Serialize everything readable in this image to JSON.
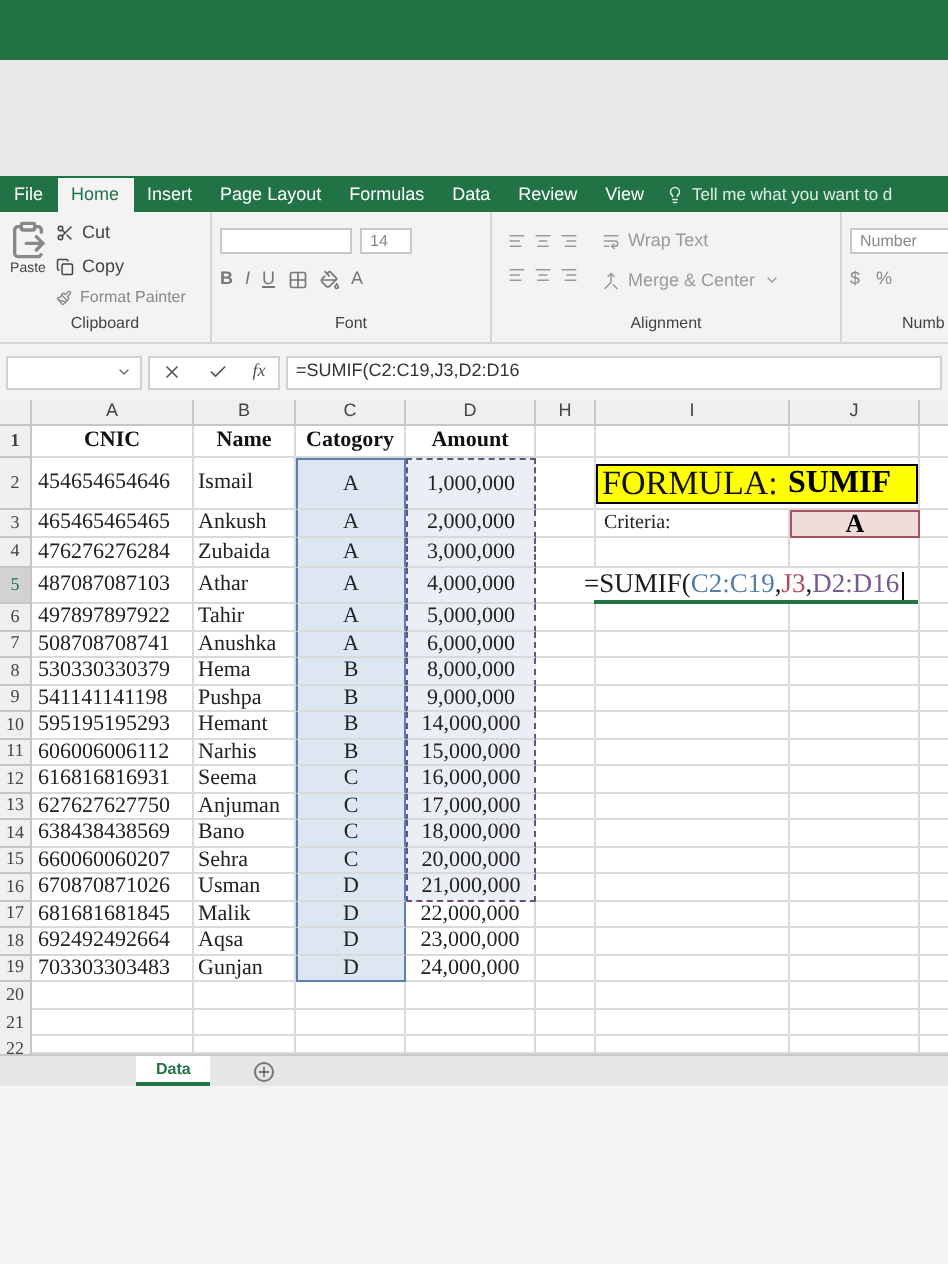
{
  "ribbon_tabs": [
    {
      "label": "File",
      "selected": false
    },
    {
      "label": "Home",
      "selected": true
    },
    {
      "label": "Insert",
      "selected": false
    },
    {
      "label": "Page Layout",
      "selected": false
    },
    {
      "label": "Formulas",
      "selected": false
    },
    {
      "label": "Data",
      "selected": false
    },
    {
      "label": "Review",
      "selected": false
    },
    {
      "label": "View",
      "selected": false
    }
  ],
  "tell_me": "Tell me what you want to d",
  "clipboard": {
    "paste": "Paste",
    "cut": "Cut",
    "copy": "Copy",
    "format_painter": "Format Painter",
    "label": "Clipboard"
  },
  "font": {
    "size": "14",
    "bold": "B",
    "italic": "I",
    "underline": "U",
    "font_color": "A",
    "label": "Font"
  },
  "alignment": {
    "wrap": "Wrap Text",
    "merge": "Merge & Center",
    "label": "Alignment"
  },
  "number": {
    "format": "Number",
    "currency": "$",
    "percent": "%",
    "label": "Numb"
  },
  "formula_bar": {
    "function_label": "fx",
    "formula": "=SUMIF(C2:C19,J3,D2:D16"
  },
  "header_row_number": "1",
  "columns": [
    "A",
    "B",
    "C",
    "D",
    "H",
    "I",
    "J"
  ],
  "headers": [
    "CNIC",
    "Name",
    "Catogory",
    "Amount"
  ],
  "rows": [
    {
      "number": "2",
      "cnic": "454654654646",
      "name": "Ismail",
      "category": "A",
      "amount": "1,000,000",
      "category_selected": true,
      "amount_marquee": true
    },
    {
      "number": "3",
      "cnic": "465465465465",
      "name": "Ankush",
      "category": "A",
      "amount": "2,000,000",
      "category_selected": true,
      "amount_marquee": true
    },
    {
      "number": "4",
      "cnic": "476276276284",
      "name": "Zubaida",
      "category": "A",
      "amount": "3,000,000",
      "category_selected": true,
      "amount_marquee": true
    },
    {
      "number": "5",
      "cnic": "487087087103",
      "name": "Athar",
      "category": "A",
      "amount": "4,000,000",
      "category_selected": true,
      "amount_marquee": true
    },
    {
      "number": "6",
      "cnic": "497897897922",
      "name": "Tahir",
      "category": "A",
      "amount": "5,000,000",
      "category_selected": true,
      "amount_marquee": true
    },
    {
      "number": "7",
      "cnic": "508708708741",
      "name": "Anushka",
      "category": "A",
      "amount": "6,000,000",
      "category_selected": true,
      "amount_marquee": true
    },
    {
      "number": "8",
      "cnic": "530330330379",
      "name": "Hema",
      "category": "B",
      "amount": "8,000,000",
      "category_selected": true,
      "amount_marquee": true
    },
    {
      "number": "9",
      "cnic": "541141141198",
      "name": "Pushpa",
      "category": "B",
      "amount": "9,000,000",
      "category_selected": true,
      "amount_marquee": true
    },
    {
      "number": "10",
      "cnic": "595195195293",
      "name": "Hemant",
      "category": "B",
      "amount": "14,000,000",
      "category_selected": true,
      "amount_marquee": true
    },
    {
      "number": "11",
      "cnic": "606006006112",
      "name": "Narhis",
      "category": "B",
      "amount": "15,000,000",
      "category_selected": true,
      "amount_marquee": true
    },
    {
      "number": "12",
      "cnic": "616816816931",
      "name": "Seema",
      "category": "C",
      "amount": "16,000,000",
      "category_selected": true,
      "amount_marquee": true
    },
    {
      "number": "13",
      "cnic": "627627627750",
      "name": "Anjuman",
      "category": "C",
      "amount": "17,000,000",
      "category_selected": true,
      "amount_marquee": true
    },
    {
      "number": "14",
      "cnic": "638438438569",
      "name": "Bano",
      "category": "C",
      "amount": "18,000,000",
      "category_selected": true,
      "amount_marquee": true
    },
    {
      "number": "15",
      "cnic": "660060060207",
      "name": "Sehra",
      "category": "C",
      "amount": "20,000,000",
      "category_selected": true,
      "amount_marquee": true
    },
    {
      "number": "16",
      "cnic": "670870871026",
      "name": "Usman",
      "category": "D",
      "amount": "21,000,000",
      "category_selected": true,
      "amount_marquee": true
    },
    {
      "number": "17",
      "cnic": "681681681845",
      "name": "Malik",
      "category": "D",
      "amount": "22,000,000",
      "category_selected": true,
      "amount_marquee": false
    },
    {
      "number": "18",
      "cnic": "692492492664",
      "name": "Aqsa",
      "category": "D",
      "amount": "23,000,000",
      "category_selected": true,
      "amount_marquee": false
    },
    {
      "number": "19",
      "cnic": "703303303483",
      "name": "Gunjan",
      "category": "D",
      "amount": "24,000,000",
      "category_selected": true,
      "amount_marquee": false
    }
  ],
  "empty_rows": [
    "20",
    "21",
    "22"
  ],
  "side_panel": {
    "title_label": "FORMULA:",
    "title_value": "SUMIF",
    "criteria_label": "Criteria:",
    "criteria_value": "A",
    "formula_entry": [
      {
        "text": "=SUMIF(",
        "color": "#1a1a1a"
      },
      {
        "text": "C2:C19",
        "color": "#4f7fa8"
      },
      {
        "text": ",",
        "color": "#1a1a1a"
      },
      {
        "text": "J3",
        "color": "#b04a5a"
      },
      {
        "text": ",",
        "color": "#1a1a1a"
      },
      {
        "text": "D2:D16",
        "color": "#7a5a8e"
      }
    ]
  },
  "sheet_tabs": [
    {
      "label": "Data",
      "selected": true
    }
  ]
}
